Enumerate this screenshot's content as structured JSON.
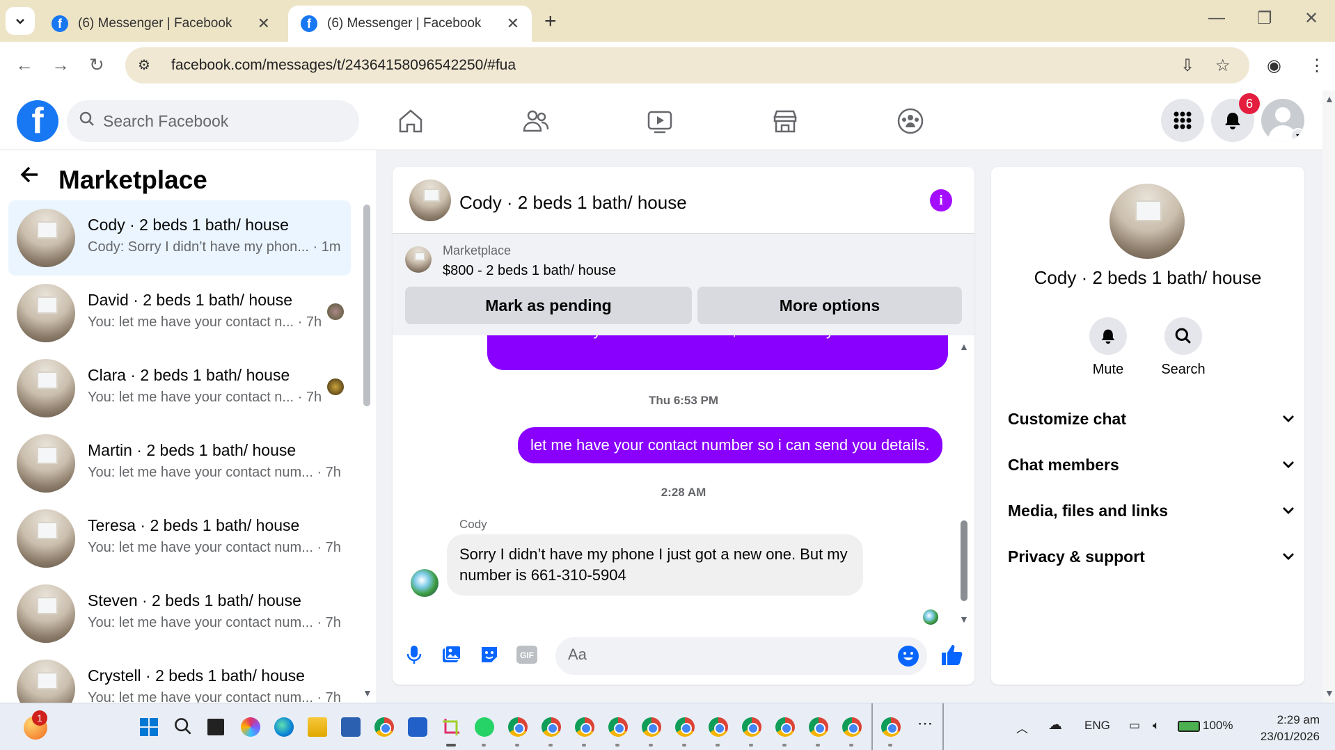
{
  "browser": {
    "tabs": [
      {
        "title": "(6) Messenger | Facebook",
        "active": false
      },
      {
        "title": "(6) Messenger | Facebook",
        "active": true
      }
    ],
    "url": "facebook.com/messages/t/24364158096542250/#fua"
  },
  "fb_header": {
    "search_placeholder": "Search Facebook",
    "notification_count": "6",
    "brand_color": "#1877f2"
  },
  "left": {
    "title": "Marketplace",
    "conversations": [
      {
        "name": "Cody · 2 beds 1 bath/ house",
        "preview": "Cody: Sorry I didn’t have my phon...",
        "time": "· 1m",
        "selected": true
      },
      {
        "name": "David · 2 beds 1 bath/ house",
        "preview": "You: let me have your contact n...",
        "time": "· 7h"
      },
      {
        "name": "Clara · 2 beds 1 bath/ house",
        "preview": "You: let me have your contact n...",
        "time": "· 7h"
      },
      {
        "name": "Martin · 2 beds 1 bath/ house",
        "preview": "You: let me have your contact num...",
        "time": "· 7h"
      },
      {
        "name": "Teresa · 2 beds 1 bath/ house",
        "preview": "You: let me have your contact num...",
        "time": "· 7h"
      },
      {
        "name": "Steven · 2 beds 1 bath/ house",
        "preview": "You: let me have your contact num...",
        "time": "· 7h"
      },
      {
        "name": "Crystell · 2 beds 1 bath/ house",
        "preview": "You: let me have your contact num...",
        "time": "· 7h"
      }
    ]
  },
  "chat": {
    "title": "Cody · 2 beds 1 bath/ house",
    "marketplace_label": "Marketplace",
    "listing": "$800 - 2 beds 1 bath/ house",
    "mark_pending": "Mark as pending",
    "more_options": "More options",
    "messages": {
      "out1": "Please share your contact number, and I'll send you the details .",
      "ts1": "Thu 6:53 PM",
      "out2": "let me have your contact number so i can send you details.",
      "ts2": "2:28 AM",
      "sender": "Cody",
      "in1": "Sorry I didn’t have my phone I just got a new one. But my number is 661-310-5904"
    },
    "composer_placeholder": "Aa",
    "accent_color": "#8a00ff"
  },
  "info": {
    "name": "Cody · 2 beds 1 bath/ house",
    "mute": "Mute",
    "search": "Search",
    "sections": [
      "Customize chat",
      "Chat members",
      "Media, files and links",
      "Privacy & support"
    ]
  },
  "taskbar": {
    "start_badge": "1",
    "lang": "ENG",
    "battery": "100%",
    "time": "2:29 am",
    "date": "23/01/2026"
  }
}
